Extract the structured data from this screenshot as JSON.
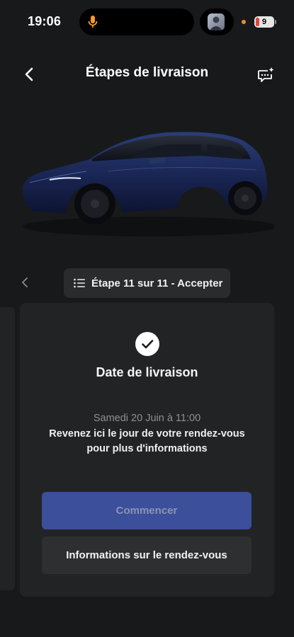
{
  "status_bar": {
    "time": "19:06",
    "battery_level": "9",
    "icons": [
      "microphone-icon",
      "avatar",
      "recording-dot",
      "battery-icon"
    ]
  },
  "header": {
    "title": "Étapes de livraison",
    "back_icon": "chevron-left-icon",
    "chat_icon": "chat-sparkle-icon"
  },
  "step_selector": {
    "label": "Étape 11 sur 11 - Accepter",
    "icon": "list-icon"
  },
  "card": {
    "title": "Date de livraison",
    "date": "Samedi 20 Juin à 11:00",
    "message": "Revenez ici le jour de votre rendez-vous pour plus d'informations",
    "primary_button": "Commencer",
    "secondary_button": "Informations sur le rendez-vous"
  },
  "colors": {
    "background": "#18191b",
    "card": "#222325",
    "primary_button": "#3c4f9a",
    "accent_orange": "#f08a2c"
  }
}
